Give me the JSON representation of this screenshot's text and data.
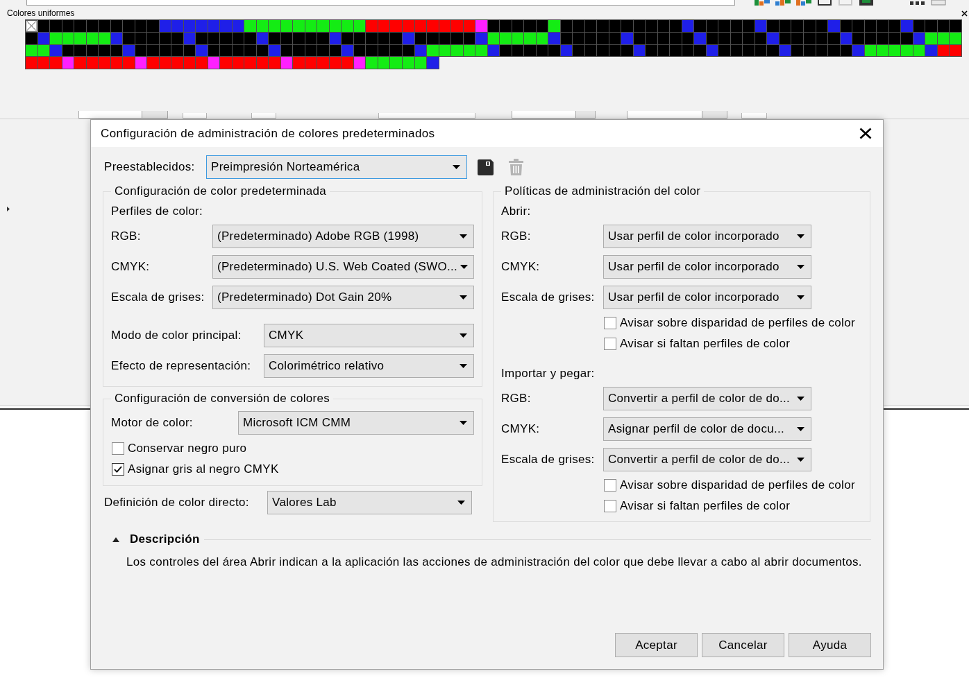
{
  "background": {
    "palette_panel": {
      "title": "Colores uniformes",
      "none_swatch": true,
      "rows": [
        [
          {
            "color": "#000000"
          },
          {
            "color": "#000000"
          },
          {
            "color": "#000000"
          },
          {
            "color": "#000000"
          },
          {
            "color": "#000000"
          },
          {
            "color": "#000000"
          },
          {
            "color": "#000000"
          },
          {
            "color": "#000000"
          },
          {
            "color": "#000000"
          },
          {
            "color": "#000000"
          },
          {
            "color": "#1f1fe8"
          },
          {
            "color": "#1f1fe8"
          },
          {
            "color": "#1f1fe8"
          },
          {
            "color": "#1f1fe8"
          },
          {
            "color": "#1f1fe8"
          },
          {
            "color": "#1f1fe8"
          },
          {
            "color": "#1f1fe8"
          },
          {
            "color": "#14ec14"
          },
          {
            "color": "#14ec14"
          },
          {
            "color": "#14ec14"
          },
          {
            "color": "#14ec14"
          },
          {
            "color": "#14ec14"
          },
          {
            "color": "#14ec14"
          },
          {
            "color": "#14ec14"
          },
          {
            "color": "#14ec14"
          },
          {
            "color": "#14ec14"
          },
          {
            "color": "#14ec14"
          },
          {
            "color": "#ff0000"
          },
          {
            "color": "#ff0000"
          },
          {
            "color": "#ff0000"
          },
          {
            "color": "#ff0000"
          },
          {
            "color": "#ff0000"
          },
          {
            "color": "#ff0000"
          },
          {
            "color": "#ff0000"
          },
          {
            "color": "#ff0000"
          },
          {
            "color": "#ff0000"
          },
          {
            "color": "#ff20ff"
          },
          {
            "color": "#000000"
          },
          {
            "color": "#000000"
          },
          {
            "color": "#000000"
          },
          {
            "color": "#000000"
          },
          {
            "color": "#000000"
          },
          {
            "color": "#14ec14"
          },
          {
            "color": "#000000"
          },
          {
            "color": "#000000"
          },
          {
            "color": "#000000"
          },
          {
            "color": "#000000"
          },
          {
            "color": "#000000"
          },
          {
            "color": "#000000"
          },
          {
            "color": "#000000"
          },
          {
            "color": "#000000"
          },
          {
            "color": "#000000"
          },
          {
            "color": "#000000"
          },
          {
            "color": "#1f1fe8"
          },
          {
            "color": "#000000"
          },
          {
            "color": "#000000"
          },
          {
            "color": "#000000"
          },
          {
            "color": "#000000"
          },
          {
            "color": "#000000"
          },
          {
            "color": "#1f1fe8"
          },
          {
            "color": "#000000"
          },
          {
            "color": "#000000"
          },
          {
            "color": "#000000"
          },
          {
            "color": "#000000"
          },
          {
            "color": "#000000"
          },
          {
            "color": "#1f1fe8"
          },
          {
            "color": "#000000"
          },
          {
            "color": "#000000"
          },
          {
            "color": "#000000"
          },
          {
            "color": "#000000"
          },
          {
            "color": "#000000"
          },
          {
            "color": "#1f1fe8"
          },
          {
            "color": "#000000"
          },
          {
            "color": "#000000"
          },
          {
            "color": "#000000"
          },
          {
            "color": "#000000"
          }
        ],
        [
          {
            "color": "#000000"
          },
          {
            "color": "#1f1fe8"
          },
          {
            "color": "#14ec14"
          },
          {
            "color": "#14ec14"
          },
          {
            "color": "#14ec14"
          },
          {
            "color": "#14ec14"
          },
          {
            "color": "#14ec14"
          },
          {
            "color": "#1f1fe8"
          },
          {
            "color": "#000000"
          },
          {
            "color": "#000000"
          },
          {
            "color": "#000000"
          },
          {
            "color": "#000000"
          },
          {
            "color": "#000000"
          },
          {
            "color": "#1f1fe8"
          },
          {
            "color": "#000000"
          },
          {
            "color": "#000000"
          },
          {
            "color": "#000000"
          },
          {
            "color": "#000000"
          },
          {
            "color": "#000000"
          },
          {
            "color": "#1f1fe8"
          },
          {
            "color": "#000000"
          },
          {
            "color": "#000000"
          },
          {
            "color": "#000000"
          },
          {
            "color": "#000000"
          },
          {
            "color": "#000000"
          },
          {
            "color": "#1f1fe8"
          },
          {
            "color": "#000000"
          },
          {
            "color": "#000000"
          },
          {
            "color": "#000000"
          },
          {
            "color": "#000000"
          },
          {
            "color": "#000000"
          },
          {
            "color": "#1f1fe8"
          },
          {
            "color": "#000000"
          },
          {
            "color": "#000000"
          },
          {
            "color": "#000000"
          },
          {
            "color": "#000000"
          },
          {
            "color": "#000000"
          },
          {
            "color": "#1f1fe8"
          },
          {
            "color": "#14ec14"
          },
          {
            "color": "#14ec14"
          },
          {
            "color": "#14ec14"
          },
          {
            "color": "#14ec14"
          },
          {
            "color": "#14ec14"
          },
          {
            "color": "#1f1fe8"
          },
          {
            "color": "#000000"
          },
          {
            "color": "#000000"
          },
          {
            "color": "#000000"
          },
          {
            "color": "#000000"
          },
          {
            "color": "#000000"
          },
          {
            "color": "#1f1fe8"
          },
          {
            "color": "#000000"
          },
          {
            "color": "#000000"
          },
          {
            "color": "#000000"
          },
          {
            "color": "#000000"
          },
          {
            "color": "#000000"
          },
          {
            "color": "#1f1fe8"
          },
          {
            "color": "#000000"
          },
          {
            "color": "#000000"
          },
          {
            "color": "#000000"
          },
          {
            "color": "#000000"
          },
          {
            "color": "#000000"
          },
          {
            "color": "#1f1fe8"
          },
          {
            "color": "#000000"
          },
          {
            "color": "#000000"
          },
          {
            "color": "#000000"
          },
          {
            "color": "#000000"
          },
          {
            "color": "#000000"
          },
          {
            "color": "#1f1fe8"
          },
          {
            "color": "#000000"
          },
          {
            "color": "#000000"
          },
          {
            "color": "#000000"
          },
          {
            "color": "#000000"
          },
          {
            "color": "#000000"
          },
          {
            "color": "#1f1fe8"
          },
          {
            "color": "#14ec14"
          },
          {
            "color": "#14ec14"
          },
          {
            "color": "#14ec14"
          }
        ],
        [
          {
            "color": "#14ec14"
          },
          {
            "color": "#14ec14"
          },
          {
            "color": "#1f1fe8"
          },
          {
            "color": "#000000"
          },
          {
            "color": "#000000"
          },
          {
            "color": "#000000"
          },
          {
            "color": "#000000"
          },
          {
            "color": "#000000"
          },
          {
            "color": "#1f1fe8"
          },
          {
            "color": "#000000"
          },
          {
            "color": "#000000"
          },
          {
            "color": "#000000"
          },
          {
            "color": "#000000"
          },
          {
            "color": "#000000"
          },
          {
            "color": "#1f1fe8"
          },
          {
            "color": "#000000"
          },
          {
            "color": "#000000"
          },
          {
            "color": "#000000"
          },
          {
            "color": "#000000"
          },
          {
            "color": "#000000"
          },
          {
            "color": "#1f1fe8"
          },
          {
            "color": "#000000"
          },
          {
            "color": "#000000"
          },
          {
            "color": "#000000"
          },
          {
            "color": "#000000"
          },
          {
            "color": "#000000"
          },
          {
            "color": "#1f1fe8"
          },
          {
            "color": "#000000"
          },
          {
            "color": "#000000"
          },
          {
            "color": "#000000"
          },
          {
            "color": "#000000"
          },
          {
            "color": "#000000"
          },
          {
            "color": "#1f1fe8"
          },
          {
            "color": "#14ec14"
          },
          {
            "color": "#14ec14"
          },
          {
            "color": "#14ec14"
          },
          {
            "color": "#14ec14"
          },
          {
            "color": "#14ec14"
          },
          {
            "color": "#1f1fe8"
          },
          {
            "color": "#000000"
          },
          {
            "color": "#000000"
          },
          {
            "color": "#000000"
          },
          {
            "color": "#000000"
          },
          {
            "color": "#000000"
          },
          {
            "color": "#1f1fe8"
          },
          {
            "color": "#000000"
          },
          {
            "color": "#000000"
          },
          {
            "color": "#000000"
          },
          {
            "color": "#000000"
          },
          {
            "color": "#000000"
          },
          {
            "color": "#1f1fe8"
          },
          {
            "color": "#000000"
          },
          {
            "color": "#000000"
          },
          {
            "color": "#000000"
          },
          {
            "color": "#000000"
          },
          {
            "color": "#000000"
          },
          {
            "color": "#1f1fe8"
          },
          {
            "color": "#000000"
          },
          {
            "color": "#000000"
          },
          {
            "color": "#000000"
          },
          {
            "color": "#000000"
          },
          {
            "color": "#000000"
          },
          {
            "color": "#1f1fe8"
          },
          {
            "color": "#000000"
          },
          {
            "color": "#000000"
          },
          {
            "color": "#000000"
          },
          {
            "color": "#000000"
          },
          {
            "color": "#000000"
          },
          {
            "color": "#1f1fe8"
          },
          {
            "color": "#14ec14"
          },
          {
            "color": "#14ec14"
          },
          {
            "color": "#14ec14"
          },
          {
            "color": "#14ec14"
          },
          {
            "color": "#14ec14"
          },
          {
            "color": "#1f1fe8"
          },
          {
            "color": "#ff0000"
          },
          {
            "color": "#ff0000"
          }
        ],
        [
          {
            "color": "#ff0000"
          },
          {
            "color": "#ff0000"
          },
          {
            "color": "#ff0000"
          },
          {
            "color": "#ff20ff"
          },
          {
            "color": "#ff0000"
          },
          {
            "color": "#ff0000"
          },
          {
            "color": "#ff0000"
          },
          {
            "color": "#ff0000"
          },
          {
            "color": "#ff0000"
          },
          {
            "color": "#ff20ff"
          },
          {
            "color": "#ff0000"
          },
          {
            "color": "#ff0000"
          },
          {
            "color": "#ff0000"
          },
          {
            "color": "#ff0000"
          },
          {
            "color": "#ff0000"
          },
          {
            "color": "#ff20ff"
          },
          {
            "color": "#ff0000"
          },
          {
            "color": "#ff0000"
          },
          {
            "color": "#ff0000"
          },
          {
            "color": "#ff0000"
          },
          {
            "color": "#ff0000"
          },
          {
            "color": "#ff20ff"
          },
          {
            "color": "#ff0000"
          },
          {
            "color": "#ff0000"
          },
          {
            "color": "#ff0000"
          },
          {
            "color": "#ff0000"
          },
          {
            "color": "#ff0000"
          },
          {
            "color": "#ff20ff"
          },
          {
            "color": "#14ec14"
          },
          {
            "color": "#14ec14"
          },
          {
            "color": "#14ec14"
          },
          {
            "color": "#14ec14"
          },
          {
            "color": "#14ec14"
          },
          {
            "color": "#1f1fe8"
          }
        ]
      ]
    }
  },
  "dialog": {
    "title": "Configuración de administración de colores predeterminados",
    "presets": {
      "label": "Preestablecidos:",
      "value": "Preimpresión Norteamérica",
      "focused": true,
      "actions": [
        {
          "kind": "save",
          "disabled": false
        },
        {
          "kind": "delete",
          "disabled": true
        }
      ]
    },
    "default_settings": {
      "title": "Configuración de color predeterminada",
      "subheading": "Perfiles de color:",
      "profiles": [
        {
          "label": "RGB:",
          "value": "(Predeterminado) Adobe RGB (1998)"
        },
        {
          "label": "CMYK:",
          "value": "(Predeterminado) U.S. Web Coated (SWO..."
        },
        {
          "label": "Escala de grises:",
          "value": "(Predeterminado) Dot Gain 20%"
        }
      ],
      "options": [
        {
          "label": "Modo de color principal:",
          "value": "CMYK"
        },
        {
          "label": "Efecto de representación:",
          "value": "Colorimétrico relativo"
        }
      ]
    },
    "conversion": {
      "title": "Configuración de conversión de colores",
      "engine": {
        "label": "Motor de color:",
        "value": "Microsoft ICM CMM"
      },
      "checkboxes": [
        {
          "label": "Conservar negro puro",
          "checked": false
        },
        {
          "label": "Asignar gris al negro CMYK",
          "checked": true
        }
      ]
    },
    "spot_color": {
      "label": "Definición de color directo:",
      "value": "Valores Lab"
    },
    "policies": {
      "title": "Políticas de administración del color",
      "sections": [
        {
          "heading": "Abrir:",
          "rows": [
            {
              "label": "RGB:",
              "value": "Usar perfil de color incorporado"
            },
            {
              "label": "CMYK:",
              "value": "Usar perfil de color incorporado"
            },
            {
              "label": "Escala de grises:",
              "value": "Usar perfil de color incorporado"
            }
          ],
          "checkboxes": [
            {
              "label": "Avisar sobre disparidad de perfiles de color",
              "checked": false
            },
            {
              "label": "Avisar si faltan perfiles de color",
              "checked": false
            }
          ]
        },
        {
          "heading": "Importar y pegar:",
          "rows": [
            {
              "label": "RGB:",
              "value": "Convertir a perfil de color de do..."
            },
            {
              "label": "CMYK:",
              "value": "Asignar perfil de color de docu..."
            },
            {
              "label": "Escala de grises:",
              "value": "Convertir a perfil de color de do..."
            }
          ],
          "checkboxes": [
            {
              "label": "Avisar sobre disparidad de perfiles de color",
              "checked": false
            },
            {
              "label": "Avisar si faltan perfiles de color",
              "checked": false
            }
          ]
        }
      ]
    },
    "description": {
      "heading": "Descripción",
      "expanded": true,
      "text": "Los controles del área Abrir indican a la aplicación las acciones de administración del color que debe llevar a cabo al abrir documentos."
    },
    "buttons": [
      {
        "label": "Aceptar"
      },
      {
        "label": "Cancelar"
      },
      {
        "label": "Ayuda"
      }
    ]
  }
}
